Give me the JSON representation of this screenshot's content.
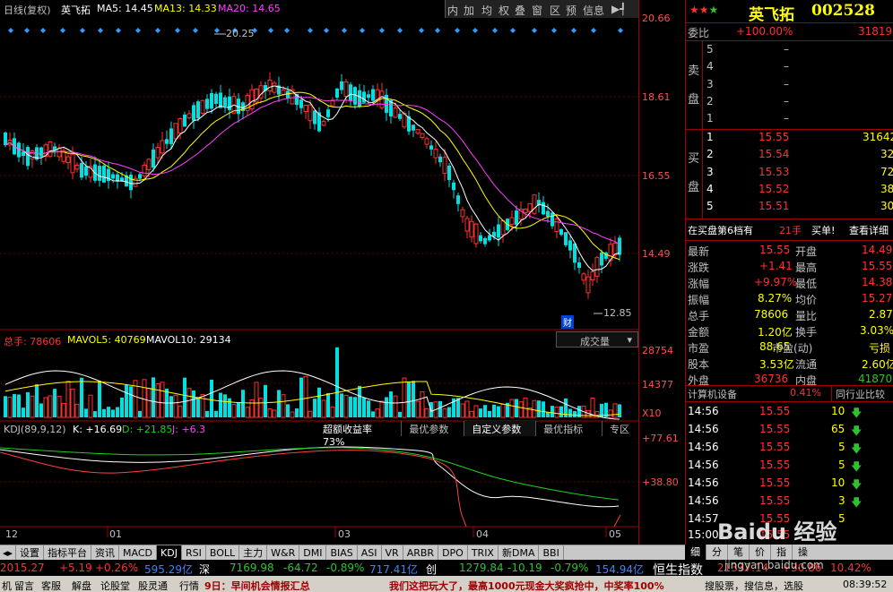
{
  "header": {
    "title": "日线(复权)",
    "stock_name": "英飞拓",
    "ma5": "MA5: 14.45",
    "ma13": "MA13: 14.33",
    "ma20": "MA20: 14.65"
  },
  "toolbar": [
    "内",
    "加",
    "均",
    "权",
    "叠",
    "窗",
    "区",
    "预",
    "信息",
    "▶┩"
  ],
  "price_axis": [
    "20.66",
    "18.61",
    "16.55",
    "14.49"
  ],
  "annotations": {
    "high": "20.25",
    "low": "12.85",
    "cai": "财"
  },
  "volume": {
    "label": "总手: 78606",
    "mavol5": "MAVOL5: 40769",
    "mavol10": "MAVOL10: 29134",
    "dropdown": "成交量",
    "axis": [
      "28754",
      "14377",
      "X10"
    ]
  },
  "kdj": {
    "label": "KDJ(89,9,12)",
    "k": "K: +16.69",
    "d": "D: +21.85",
    "j": "J: +6.3",
    "axis": [
      "+77.61",
      "+38.80"
    ],
    "tabs": [
      "超额收益率73%",
      "最优参数",
      "自定义参数",
      "最优指标",
      "专区"
    ]
  },
  "date_axis": [
    "12",
    "01",
    "03",
    "04",
    "05"
  ],
  "bottom_tabs": [
    "设置",
    "指标平台",
    "资讯",
    "MACD",
    "KDJ",
    "RSI",
    "BOLL",
    "主力",
    "W&R",
    "DMI",
    "BIAS",
    "ASI",
    "VR",
    "ARBR",
    "DPO",
    "TRIX",
    "新DMA",
    "BBI"
  ],
  "quote": {
    "name": "英飞拓",
    "code": "002528",
    "weibi_label": "委比",
    "weibi": "+100.00%",
    "weibi_val": "31819",
    "sell_side_label": "卖盘",
    "buy_side_label": "买盘",
    "sell": [
      {
        "n": "5",
        "p": "–"
      },
      {
        "n": "4",
        "p": "–"
      },
      {
        "n": "3",
        "p": "–"
      },
      {
        "n": "2",
        "p": "–"
      },
      {
        "n": "1",
        "p": "–"
      }
    ],
    "buy": [
      {
        "n": "1",
        "p": "15.55",
        "v": "31642"
      },
      {
        "n": "2",
        "p": "15.54",
        "v": "32"
      },
      {
        "n": "3",
        "p": "15.53",
        "v": "72"
      },
      {
        "n": "4",
        "p": "15.52",
        "v": "38"
      },
      {
        "n": "5",
        "p": "15.51",
        "v": "30"
      }
    ],
    "level6": "在买盘第6档有",
    "level6_qty": "21手",
    "buy_one": "买单!",
    "detail": "查看详细",
    "stats": [
      {
        "l": "最新",
        "v": "15.55",
        "l2": "开盘",
        "v2": "14.49"
      },
      {
        "l": "涨跌",
        "v": "+1.41",
        "l2": "最高",
        "v2": "15.55"
      },
      {
        "l": "涨幅",
        "v": "+9.97%",
        "l2": "最低",
        "v2": "14.38"
      },
      {
        "l": "振幅",
        "v": "8.27%",
        "l2": "均价",
        "v2": "15.27"
      },
      {
        "l": "总手",
        "v": "78606",
        "l2": "量比",
        "v2": "2.87"
      },
      {
        "l": "金额",
        "v": "1.20亿",
        "l2": "换手",
        "v2": "3.03%"
      },
      {
        "l": "市盈",
        "v": "88.65",
        "l2": "市盈(动)",
        "v2": "亏损"
      },
      {
        "l": "股本",
        "v": "3.53亿",
        "l2": "流通",
        "v2": "2.60亿"
      },
      {
        "l": "外盘",
        "v": "36736",
        "l2": "内盘",
        "v2": "41870"
      }
    ],
    "sector": "计算机设备",
    "sector_pct": "0.41%",
    "compare": "同行业比较",
    "ticks": [
      {
        "t": "14:56",
        "p": "15.55",
        "v": "10"
      },
      {
        "t": "14:56",
        "p": "15.55",
        "v": "65"
      },
      {
        "t": "14:56",
        "p": "15.55",
        "v": "5"
      },
      {
        "t": "14:56",
        "p": "15.55",
        "v": "5"
      },
      {
        "t": "14:56",
        "p": "15.55",
        "v": "10"
      },
      {
        "t": "14:56",
        "p": "15.55",
        "v": "3"
      },
      {
        "t": "14:57",
        "p": "15.55",
        "v": "5"
      },
      {
        "t": "15:00",
        "p": "15.55",
        "v": ""
      }
    ],
    "side_tabs": [
      "细",
      "分",
      "笔",
      "价",
      "指",
      "操"
    ]
  },
  "ticker1": {
    "a": "2015.27",
    "b": "+5.19",
    "c": "+0.26%",
    "d": "595.29亿",
    "e": "深",
    "f": "7169.98",
    "g": "-64.72",
    "h": "-0.89%",
    "i": "717.41亿",
    "j": "创",
    "k": "1279.84",
    "l": "-10.19",
    "m": "-0.79%",
    "n": "154.94亿",
    "o": "恒生指数",
    "p": "21337.14",
    "q": "+30.86",
    "r": "10.42%"
  },
  "ticker2": {
    "items": [
      "机",
      "留言",
      "客服",
      "解盘",
      "论股堂",
      "股灵通",
      "行情"
    ],
    "news1": "9日：早间机会情报汇总",
    "news2": "我们这把玩大了，最高1000元现金大奖疯抢中，中奖率100%",
    "right1": "搜股票，搜信息，选股",
    "time": "08:39:52"
  },
  "watermark": "Baidu 经验",
  "watermark_url": "jingyan.baidu.com"
}
